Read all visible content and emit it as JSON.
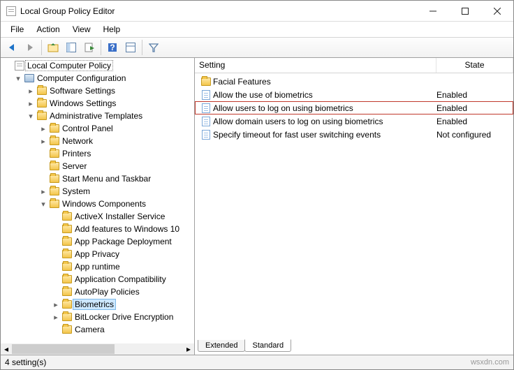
{
  "window": {
    "title": "Local Group Policy Editor"
  },
  "menu": [
    "File",
    "Action",
    "View",
    "Help"
  ],
  "tree": {
    "root": "Local Computer Policy",
    "cc": "Computer Configuration",
    "ss": "Software Settings",
    "ws": "Windows Settings",
    "at": "Administrative Templates",
    "cp": "Control Panel",
    "nw": "Network",
    "pr": "Printers",
    "sv": "Server",
    "st": "Start Menu and Taskbar",
    "sy": "System",
    "wc": "Windows Components",
    "ax": "ActiveX Installer Service",
    "af": "Add features to Windows 10",
    "apd": "App Package Deployment",
    "apv": "App Privacy",
    "apt": "App runtime",
    "ac": "Application Compatibility",
    "ap": "AutoPlay Policies",
    "bio": "Biometrics",
    "bl": "BitLocker Drive Encryption",
    "cam": "Camera"
  },
  "columns": {
    "setting": "Setting",
    "state": "State"
  },
  "settings": [
    {
      "type": "folder",
      "name": "Facial Features",
      "state": ""
    },
    {
      "type": "policy",
      "name": "Allow the use of biometrics",
      "state": "Enabled"
    },
    {
      "type": "policy",
      "name": "Allow users to log on using biometrics",
      "state": "Enabled",
      "highlight": true
    },
    {
      "type": "policy",
      "name": "Allow domain users to log on using biometrics",
      "state": "Enabled"
    },
    {
      "type": "policy",
      "name": "Specify timeout for fast user switching events",
      "state": "Not configured"
    }
  ],
  "tabs": {
    "extended": "Extended",
    "standard": "Standard"
  },
  "status": {
    "count": "4 setting(s)",
    "brand": "wsxdn.com"
  }
}
